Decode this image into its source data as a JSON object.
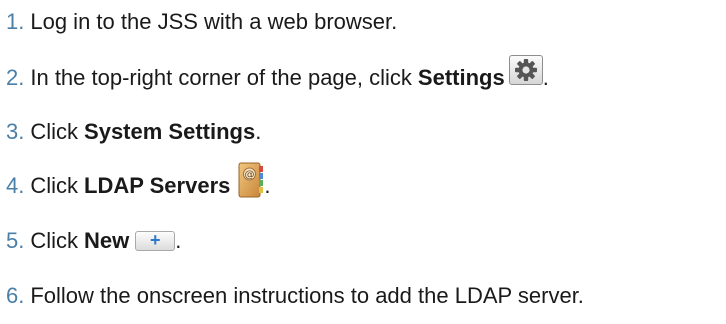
{
  "steps": [
    {
      "number": "1.",
      "parts": {
        "text1": "Log in to the JSS with a web browser."
      }
    },
    {
      "number": "2.",
      "parts": {
        "text1": "In the top-right corner of the page, click",
        "bold1": "Settings",
        "text2": "."
      },
      "icon": "gear-icon"
    },
    {
      "number": "3.",
      "parts": {
        "text1": "Click",
        "bold1": "System Settings",
        "text2": "."
      }
    },
    {
      "number": "4.",
      "parts": {
        "text1": "Click",
        "bold1": "LDAP Servers",
        "text2": "."
      },
      "icon": "address-book-icon"
    },
    {
      "number": "5.",
      "parts": {
        "text1": "Click",
        "bold1": "New",
        "text2": "."
      },
      "icon": "plus-icon",
      "icon_glyph": "+"
    },
    {
      "number": "6.",
      "parts": {
        "text1": "Follow the onscreen instructions to add the LDAP server."
      }
    }
  ],
  "colors": {
    "step_number": "#4a7fa8",
    "text": "#1a1a1a",
    "plus": "#2f78c8"
  }
}
